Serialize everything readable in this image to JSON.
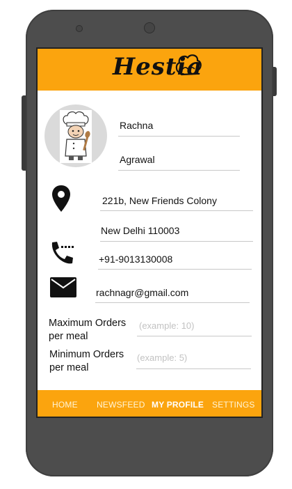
{
  "app": {
    "logo_text": "Hestia",
    "accent_color": "#fba40e"
  },
  "profile": {
    "avatar_icon": "chef-icon",
    "first_name": "Rachna",
    "last_name": "Agrawal",
    "address_line1": "221b, New Friends Colony",
    "address_line2": "New Delhi 110003",
    "phone": "+91-9013130008",
    "email": "rachnagr@gmail.com",
    "max_orders_label": "Maximum Orders per meal",
    "max_orders_placeholder": "(example: 10)",
    "min_orders_label": "Minimum Orders per meal",
    "min_orders_placeholder": "(example: 5)"
  },
  "icons": {
    "location": "location-pin-icon",
    "phone": "phone-icon",
    "email": "mail-icon"
  },
  "nav": {
    "items": [
      {
        "label": "HOME"
      },
      {
        "label": "NEWSFEED"
      },
      {
        "label": "MY PROFILE"
      },
      {
        "label": "SETTINGS"
      }
    ],
    "active_index": 2
  }
}
